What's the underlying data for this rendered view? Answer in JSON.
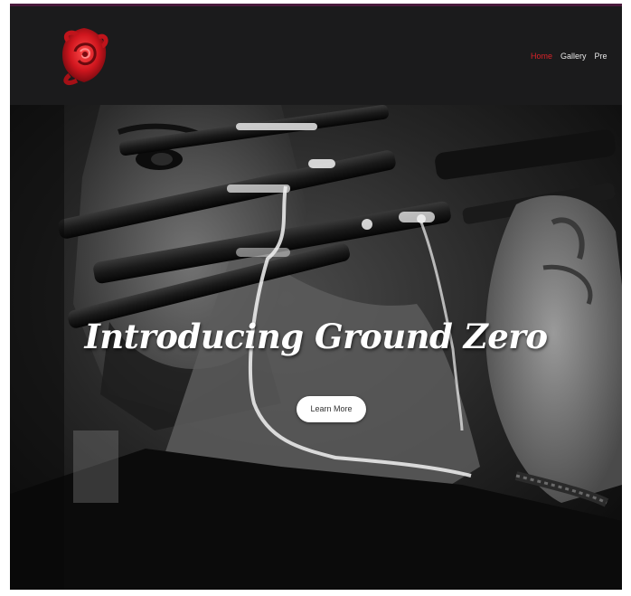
{
  "brand": {
    "logo_icon": "red-rose-emblem-icon",
    "accent_color": "#d8232a"
  },
  "nav": {
    "items": [
      "Home",
      "Gallery",
      "Pre"
    ],
    "active_index": 0
  },
  "hero": {
    "headline": "Introducing Ground Zero",
    "cta_label": "Learn More"
  }
}
